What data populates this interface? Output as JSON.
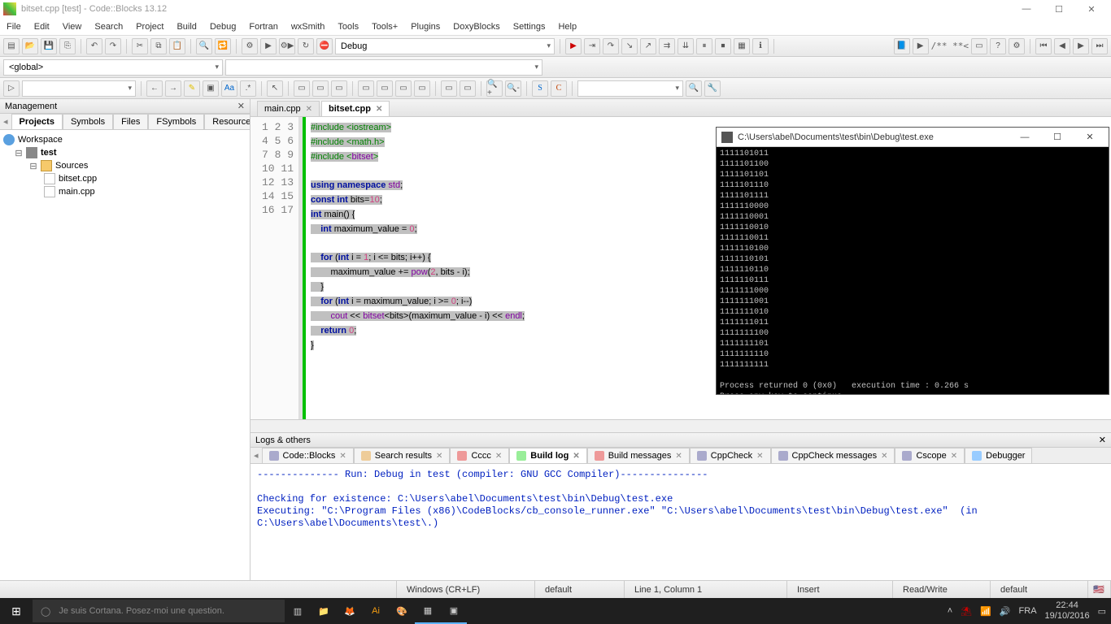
{
  "window": {
    "title": "bitset.cpp [test] - Code::Blocks 13.12"
  },
  "menu": [
    "File",
    "Edit",
    "View",
    "Search",
    "Project",
    "Build",
    "Debug",
    "Fortran",
    "wxSmith",
    "Tools",
    "Tools+",
    "Plugins",
    "DoxyBlocks",
    "Settings",
    "Help"
  ],
  "configCombo": "Debug",
  "scopeCombo": "<global>",
  "management": {
    "title": "Management",
    "tabs": [
      "Projects",
      "Symbols",
      "Files",
      "FSymbols",
      "Resources"
    ],
    "activeTab": 0,
    "tree": {
      "workspace": "Workspace",
      "project": "test",
      "folder": "Sources",
      "files": [
        "bitset.cpp",
        "main.cpp"
      ]
    }
  },
  "editorTabs": [
    {
      "label": "main.cpp",
      "active": false
    },
    {
      "label": "bitset.cpp",
      "active": true
    }
  ],
  "code": {
    "lines": 17,
    "src": [
      "#include <iostream>",
      "#include <math.h>",
      "#include <bitset>",
      "",
      "using namespace std;",
      "const int bits=10;",
      "int main() {",
      "    int maximum_value = 0;",
      "",
      "    for (int i = 1; i <= bits; i++) {",
      "        maximum_value += pow(2, bits - i);",
      "    }",
      "    for (int i = maximum_value; i >= 0; i--)",
      "        cout << bitset<bits>(maximum_value - i) << endl;",
      "    return 0;",
      "}",
      ""
    ]
  },
  "console": {
    "title": "C:\\Users\\abel\\Documents\\test\\bin\\Debug\\test.exe",
    "lines": [
      "1111101011",
      "1111101100",
      "1111101101",
      "1111101110",
      "1111101111",
      "1111110000",
      "1111110001",
      "1111110010",
      "1111110011",
      "1111110100",
      "1111110101",
      "1111110110",
      "1111110111",
      "1111111000",
      "1111111001",
      "1111111010",
      "1111111011",
      "1111111100",
      "1111111101",
      "1111111110",
      "1111111111",
      "",
      "Process returned 0 (0x0)   execution time : 0.266 s",
      "Press any key to continue."
    ]
  },
  "logs": {
    "title": "Logs & others",
    "tabs": [
      "Code::Blocks",
      "Search results",
      "Cccc",
      "Build log",
      "Build messages",
      "CppCheck",
      "CppCheck messages",
      "Cscope",
      "Debugger"
    ],
    "activeTab": 3,
    "body": "-------------- Run: Debug in test (compiler: GNU GCC Compiler)---------------\n\nChecking for existence: C:\\Users\\abel\\Documents\\test\\bin\\Debug\\test.exe\nExecuting: \"C:\\Program Files (x86)\\CodeBlocks/cb_console_runner.exe\" \"C:\\Users\\abel\\Documents\\test\\bin\\Debug\\test.exe\"  (in C:\\Users\\abel\\Documents\\test\\.)"
  },
  "status": {
    "eol": "Windows (CR+LF)",
    "enc": "default",
    "pos": "Line 1, Column 1",
    "ins": "Insert",
    "rw": "Read/Write",
    "lang": "default"
  },
  "taskbar": {
    "searchPlaceholder": "Je suis Cortana. Posez-moi une question.",
    "lang": "FRA",
    "time": "22:44",
    "date": "19/10/2016"
  }
}
